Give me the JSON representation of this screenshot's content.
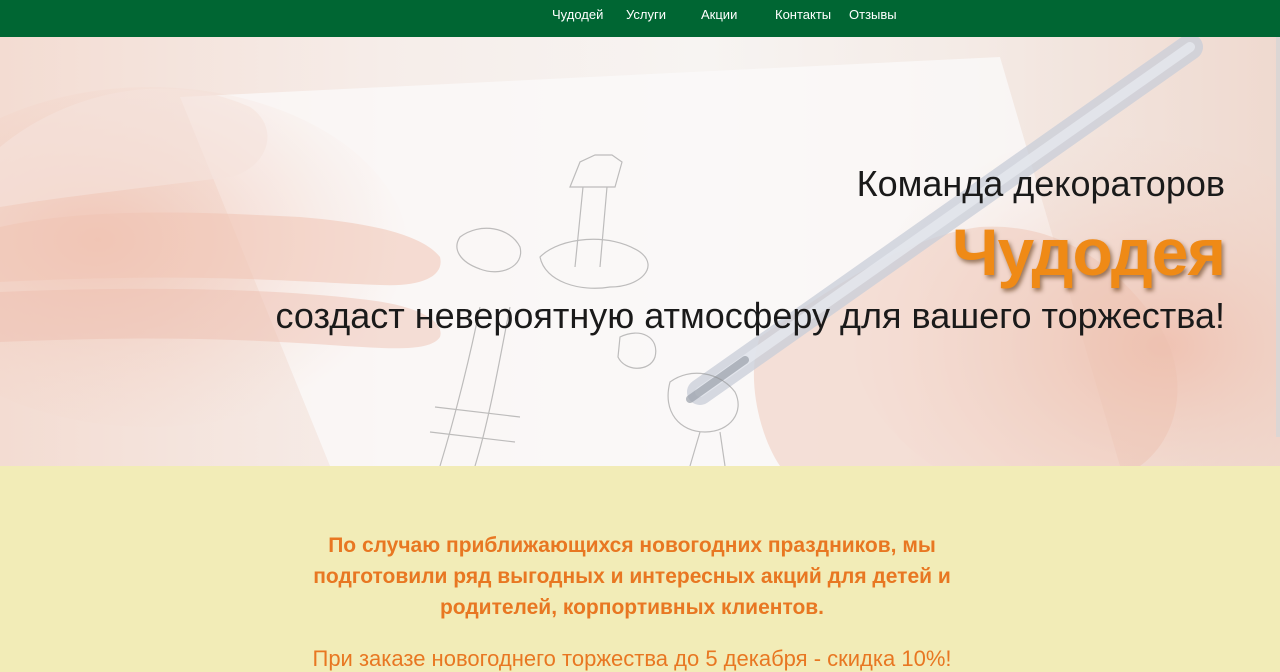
{
  "nav": {
    "items": [
      "Чудодей",
      "Услуги",
      "Акции",
      "Контакты",
      "Отзывы"
    ]
  },
  "hero": {
    "line1": "Команда декораторов",
    "brand": "Чудодея",
    "line3": "создаст невероятную атмосферу для вашего торжества!"
  },
  "promo": {
    "text": "По случаю приближающихся новогодних праздников, мы подготовили ряд выгодных и интересных акций для детей и родителей, корпортивных клиентов.",
    "discount": "При заказе новогоднего торжества до 5 декабря - скидка 10%!"
  },
  "colors": {
    "nav_bg": "#006633",
    "accent": "#ef8a16",
    "promo_bg": "#f2ecb7",
    "promo_text": "#e87722"
  }
}
